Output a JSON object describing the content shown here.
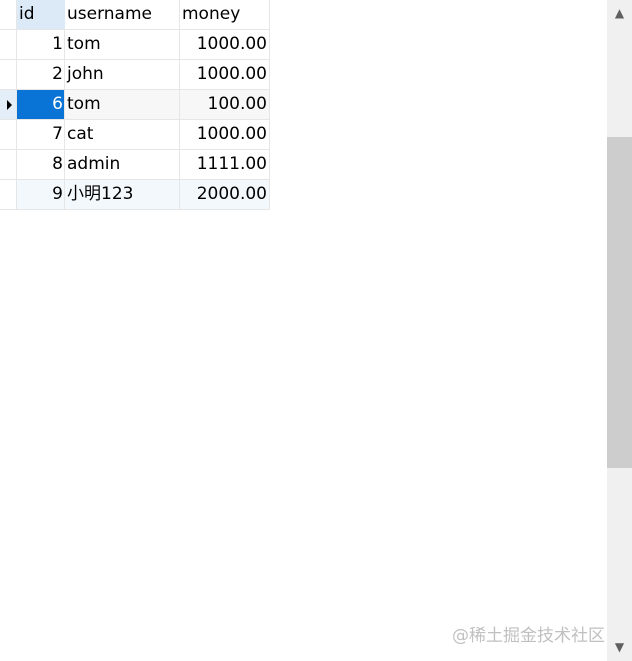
{
  "columns": [
    "id",
    "username",
    "money"
  ],
  "rows": [
    {
      "id": "1",
      "username": "tom",
      "money": "1000.00"
    },
    {
      "id": "2",
      "username": "john",
      "money": "1000.00"
    },
    {
      "id": "6",
      "username": "tom",
      "money": "100.00"
    },
    {
      "id": "7",
      "username": "cat",
      "money": "1000.00"
    },
    {
      "id": "8",
      "username": "admin",
      "money": "1111.00"
    },
    {
      "id": "9",
      "username": "小明123",
      "money": "2000.00"
    }
  ],
  "selected_row_index": 2,
  "selection_color": "#0a74d6",
  "watermark": "@稀土掘金技术社区",
  "scrollbar": {
    "up_icon": "chevron-up-icon",
    "down_icon": "chevron-down-icon"
  }
}
